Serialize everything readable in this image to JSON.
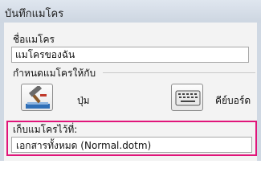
{
  "window": {
    "title": "บันทึกแมโคร"
  },
  "macro_name": {
    "label": "ชื่อแมโคร",
    "value": "แมโครของฉัน"
  },
  "assign": {
    "label": "กำหนดแมโครให้กับ",
    "button_label": "ปุ่ม",
    "keyboard_label": "คีย์บอร์ด"
  },
  "store": {
    "label": "เก็บแมโครไว้ที่:",
    "selected": "เอกสารทั้งหมด (Normal.dotm)"
  },
  "colors": {
    "highlight": "#e0157a"
  }
}
